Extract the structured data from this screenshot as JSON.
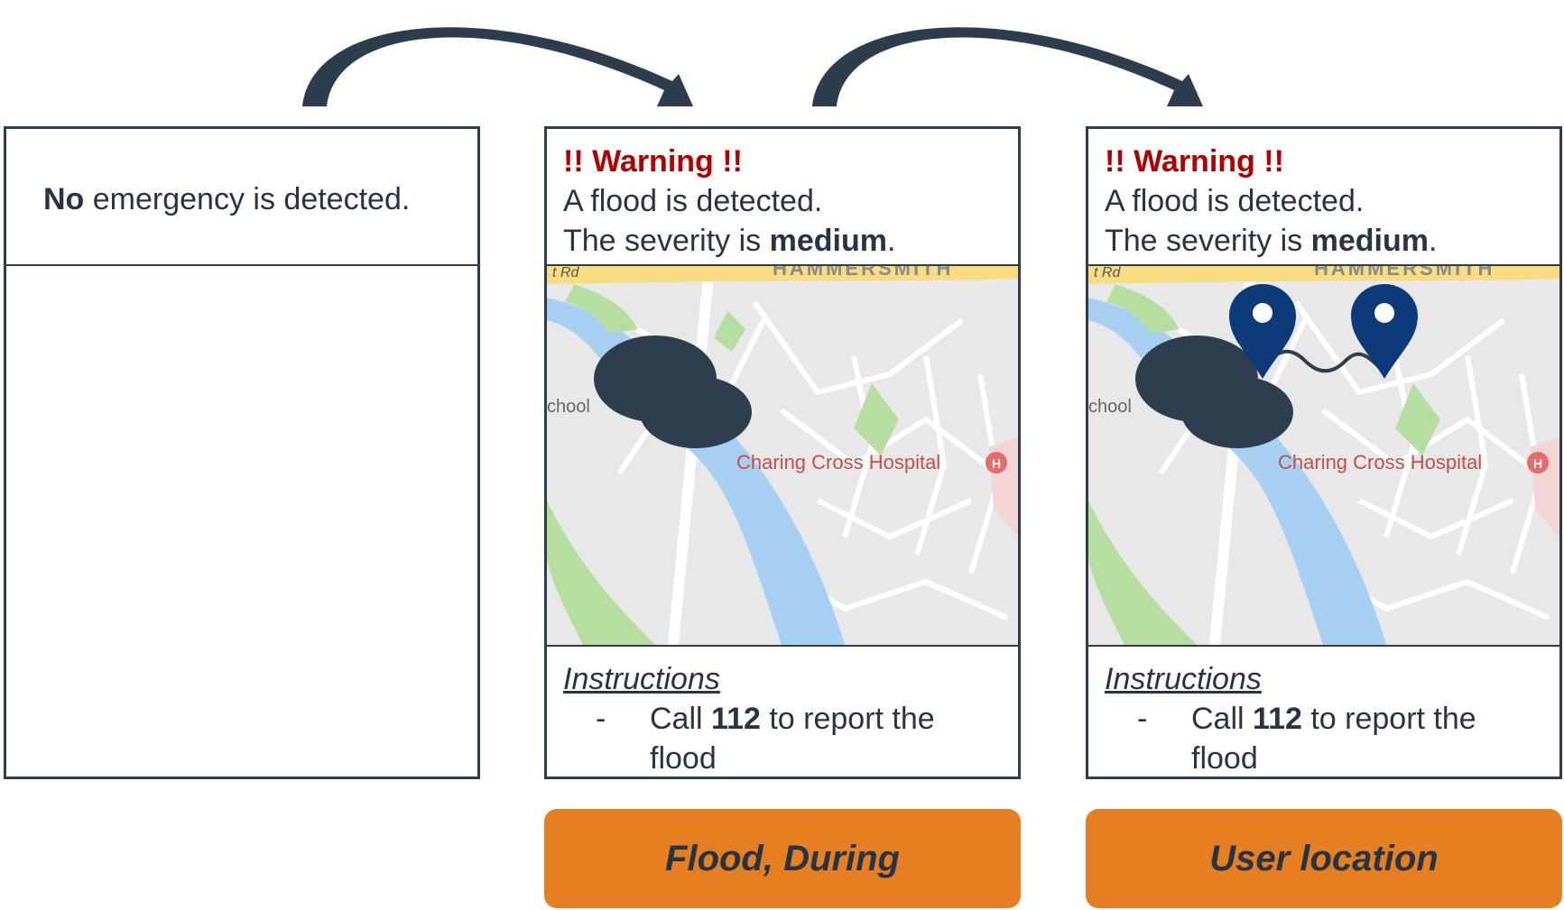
{
  "panels": [
    {
      "header": {
        "bold_word": "No",
        "text": " emergency is detected."
      }
    },
    {
      "header": {
        "warning": "!! Warning !!",
        "line1": "A flood is detected.",
        "line2_prefix": "The severity is ",
        "severity": "medium",
        "line2_suffix": "."
      },
      "map": {
        "road_label": "t Rd",
        "district_label": "HAMMERSMITH",
        "school_label": "chool",
        "hospital_label": "Charing Cross Hospital",
        "hospital_icon": "hospital-icon"
      },
      "instructions": {
        "title": "Instructions",
        "dash": "-",
        "call_prefix": "Call ",
        "number": "112",
        "call_suffix": " to report the flood"
      },
      "caption": "Flood, During"
    },
    {
      "header": {
        "warning": "!! Warning !!",
        "line1": "A flood is detected.",
        "line2_prefix": "The severity is ",
        "severity": "medium",
        "line2_suffix": "."
      },
      "map": {
        "road_label": "t Rd",
        "district_label": "HAMMERSMITH",
        "school_label": "chool",
        "hospital_label": "Charing Cross Hospital",
        "hospital_icon": "hospital-icon"
      },
      "instructions": {
        "title": "Instructions",
        "dash": "-",
        "call_prefix": "Call ",
        "number": "112",
        "call_suffix": " to report the flood"
      },
      "caption": "User location"
    }
  ],
  "colors": {
    "warning": "#b00000",
    "caption_bg": "#e67e22",
    "border": "#2e3d4d",
    "cloud": "#2f3e4f",
    "pin": "#0d3a78",
    "water": "#a6cff2",
    "park": "#b5dea0",
    "main_road": "#f7dc80"
  }
}
